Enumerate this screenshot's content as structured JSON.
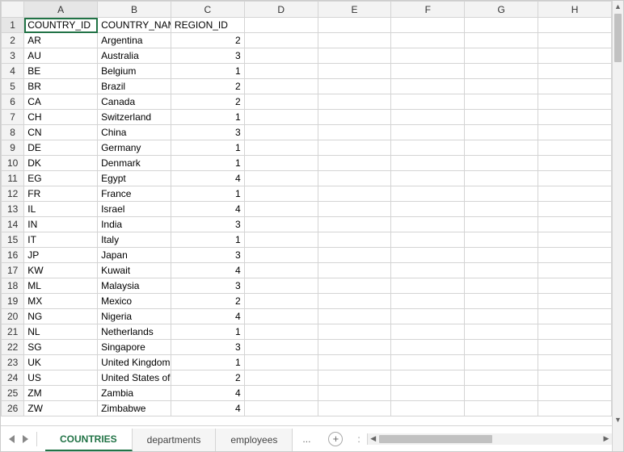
{
  "columns": [
    "A",
    "B",
    "C",
    "D",
    "E",
    "F",
    "G",
    "H"
  ],
  "rowCount": 26,
  "headers": [
    "COUNTRY_ID",
    "COUNTRY_NAME",
    "REGION_ID"
  ],
  "rows": [
    {
      "id": "AR",
      "name": "Argentina",
      "region": 2
    },
    {
      "id": "AU",
      "name": "Australia",
      "region": 3
    },
    {
      "id": "BE",
      "name": "Belgium",
      "region": 1
    },
    {
      "id": "BR",
      "name": "Brazil",
      "region": 2
    },
    {
      "id": "CA",
      "name": "Canada",
      "region": 2
    },
    {
      "id": "CH",
      "name": "Switzerland",
      "region": 1
    },
    {
      "id": "CN",
      "name": "China",
      "region": 3
    },
    {
      "id": "DE",
      "name": "Germany",
      "region": 1
    },
    {
      "id": "DK",
      "name": "Denmark",
      "region": 1
    },
    {
      "id": "EG",
      "name": "Egypt",
      "region": 4
    },
    {
      "id": "FR",
      "name": "France",
      "region": 1
    },
    {
      "id": "IL",
      "name": "Israel",
      "region": 4
    },
    {
      "id": "IN",
      "name": "India",
      "region": 3
    },
    {
      "id": "IT",
      "name": "Italy",
      "region": 1
    },
    {
      "id": "JP",
      "name": "Japan",
      "region": 3
    },
    {
      "id": "KW",
      "name": "Kuwait",
      "region": 4
    },
    {
      "id": "ML",
      "name": "Malaysia",
      "region": 3
    },
    {
      "id": "MX",
      "name": "Mexico",
      "region": 2
    },
    {
      "id": "NG",
      "name": "Nigeria",
      "region": 4
    },
    {
      "id": "NL",
      "name": "Netherlands",
      "region": 1
    },
    {
      "id": "SG",
      "name": "Singapore",
      "region": 3
    },
    {
      "id": "UK",
      "name": "United Kingdom",
      "region": 1
    },
    {
      "id": "US",
      "name": "United States of America",
      "region": 2
    },
    {
      "id": "ZM",
      "name": "Zambia",
      "region": 4
    },
    {
      "id": "ZW",
      "name": "Zimbabwe",
      "region": 4
    }
  ],
  "tabs": [
    {
      "label": "COUNTRIES",
      "active": true
    },
    {
      "label": "departments",
      "active": false
    },
    {
      "label": "employees",
      "active": false
    }
  ],
  "tabMore": "...",
  "tabAdd": "+",
  "navDots": ":",
  "activeCell": {
    "row": 1,
    "col": "A"
  },
  "chart_data": {
    "type": "table",
    "title": "COUNTRIES",
    "columns": [
      "COUNTRY_ID",
      "COUNTRY_NAME",
      "REGION_ID"
    ],
    "data": [
      [
        "AR",
        "Argentina",
        2
      ],
      [
        "AU",
        "Australia",
        3
      ],
      [
        "BE",
        "Belgium",
        1
      ],
      [
        "BR",
        "Brazil",
        2
      ],
      [
        "CA",
        "Canada",
        2
      ],
      [
        "CH",
        "Switzerland",
        1
      ],
      [
        "CN",
        "China",
        3
      ],
      [
        "DE",
        "Germany",
        1
      ],
      [
        "DK",
        "Denmark",
        1
      ],
      [
        "EG",
        "Egypt",
        4
      ],
      [
        "FR",
        "France",
        1
      ],
      [
        "IL",
        "Israel",
        4
      ],
      [
        "IN",
        "India",
        3
      ],
      [
        "IT",
        "Italy",
        1
      ],
      [
        "JP",
        "Japan",
        3
      ],
      [
        "KW",
        "Kuwait",
        4
      ],
      [
        "ML",
        "Malaysia",
        3
      ],
      [
        "MX",
        "Mexico",
        2
      ],
      [
        "NG",
        "Nigeria",
        4
      ],
      [
        "NL",
        "Netherlands",
        1
      ],
      [
        "SG",
        "Singapore",
        3
      ],
      [
        "UK",
        "United Kingdom",
        1
      ],
      [
        "US",
        "United States of America",
        2
      ],
      [
        "ZM",
        "Zambia",
        4
      ],
      [
        "ZW",
        "Zimbabwe",
        4
      ]
    ]
  }
}
